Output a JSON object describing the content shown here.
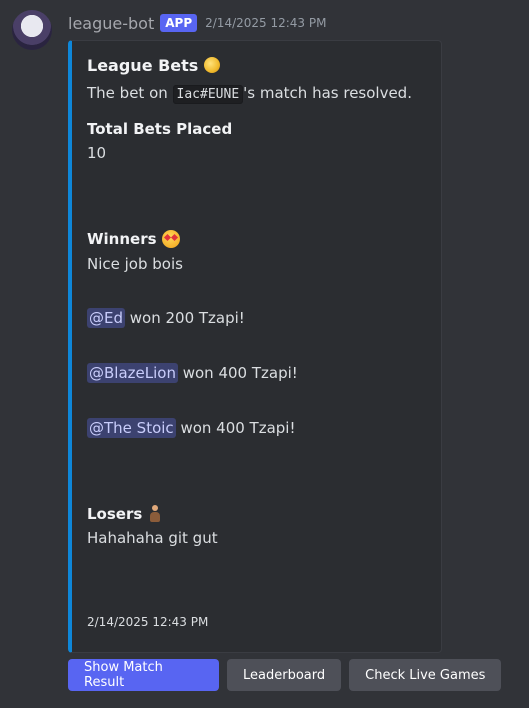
{
  "author": {
    "username": "league-bot",
    "badge": "APP",
    "timestamp": "2/14/2025 12:43 PM"
  },
  "embed": {
    "title": "League Bets",
    "description_prefix": "The bet on ",
    "description_code": "Iac#EUNE",
    "description_suffix": "'s match has resolved.",
    "fields": {
      "total_bets": {
        "name": "Total Bets Placed",
        "value": "10"
      },
      "winners": {
        "name": "Winners",
        "intro": "Nice job bois",
        "entries": [
          {
            "mention": "@Ed",
            "text": " won 200 Tzapi!"
          },
          {
            "mention": "@BlazeLion",
            "text": " won 400 Tzapi!"
          },
          {
            "mention": "@The Stoic",
            "text": " won 400 Tzapi!"
          }
        ]
      },
      "losers": {
        "name": "Losers",
        "value": "Hahahaha git gut"
      }
    },
    "footer_timestamp": "2/14/2025 12:43 PM",
    "accent_color": "#0e87d9"
  },
  "buttons": {
    "show_match_result": "Show Match Result",
    "leaderboard": "Leaderboard",
    "check_live_games": "Check Live Games"
  },
  "icons": {
    "title_emoji": "coin-icon",
    "winners_emoji": "star-struck-face-icon",
    "losers_emoji": "person-with-cane-icon"
  }
}
